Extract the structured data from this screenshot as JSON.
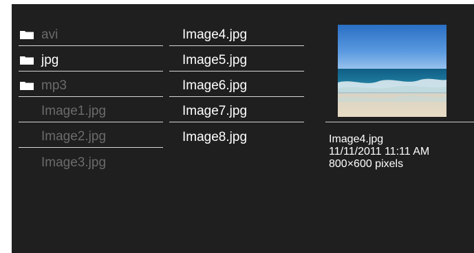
{
  "browser": {
    "folders": [
      {
        "name": "avi"
      },
      {
        "name": "jpg"
      },
      {
        "name": "mp3"
      }
    ],
    "files_col1": [
      {
        "name": "Image1.jpg"
      },
      {
        "name": "Image2.jpg"
      },
      {
        "name": "Image3.jpg"
      }
    ],
    "files_col2": [
      {
        "name": "Image4.jpg"
      },
      {
        "name": "Image5.jpg"
      },
      {
        "name": "Image6.jpg"
      },
      {
        "name": "Image7.jpg"
      },
      {
        "name": "Image8.jpg"
      }
    ]
  },
  "preview": {
    "icon": "image-thumbnail",
    "file_name": "Image4.jpg",
    "date": "11/11/2011 11:11 AM",
    "resolution": "800×600 pixels"
  },
  "colors": {
    "background": "#201f1f",
    "text_bright": "#ffffff",
    "text_dim": "#6b6b6b"
  }
}
